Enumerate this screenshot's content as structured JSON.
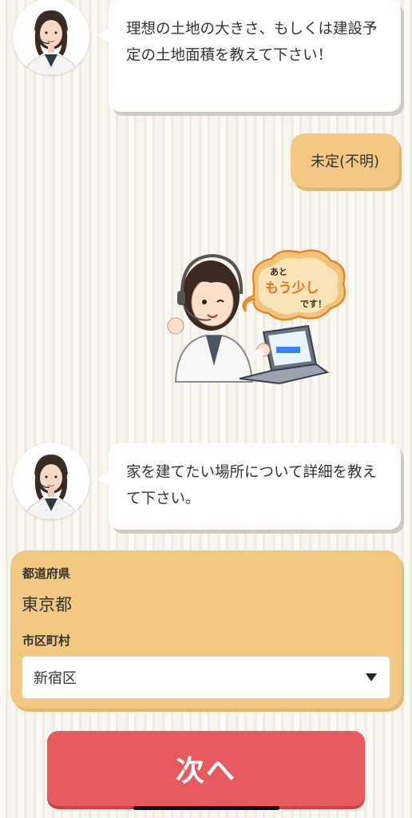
{
  "chat": {
    "q1": "理想の土地の大きさ、もしくは建設予定の土地面積を教えて下さい！",
    "a1": "未定(不明)",
    "badge": {
      "line1": "あと",
      "line2": "もう少し",
      "line3": "です！"
    },
    "q2": "家を建てたい場所について詳細を教えて下さい。"
  },
  "form": {
    "prefecture_label": "都道府県",
    "prefecture_value": "東京都",
    "city_label": "市区町村",
    "city_selected": "新宿区"
  },
  "next_button": "次へ",
  "colors": {
    "accent_orange": "#f3c882",
    "button_red": "#e85a5e"
  }
}
